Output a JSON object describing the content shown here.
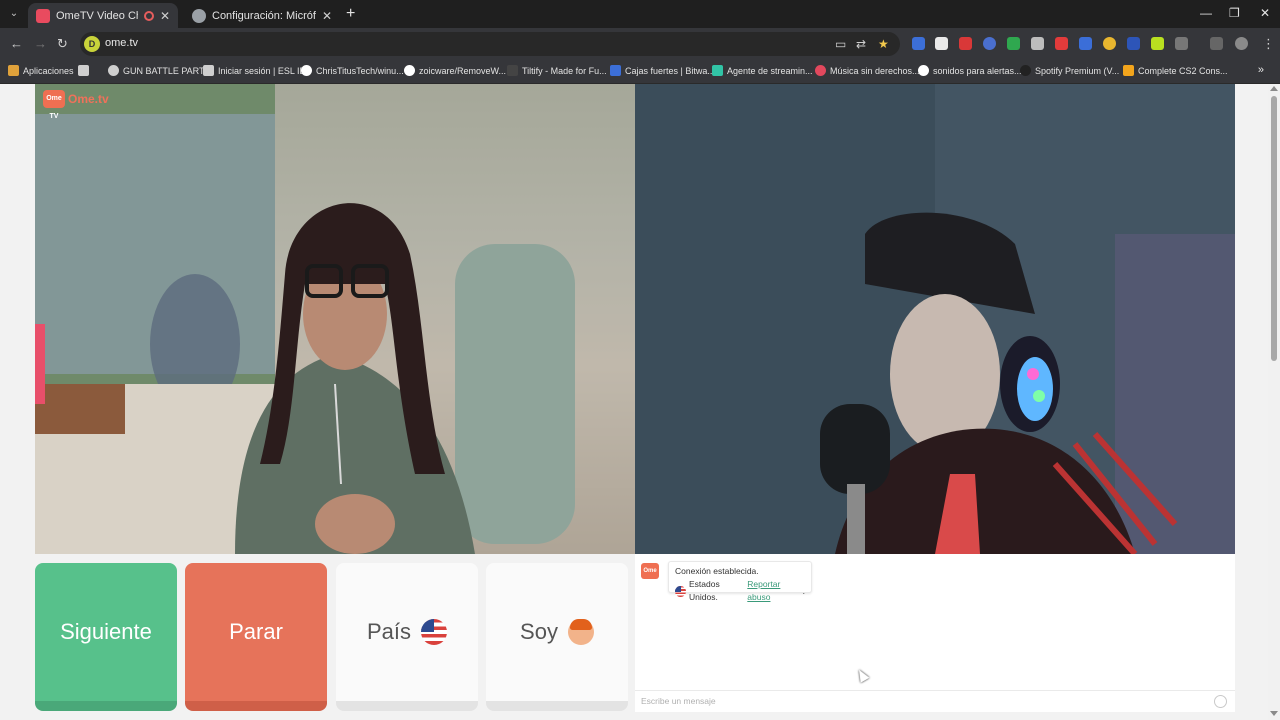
{
  "browser": {
    "tabs": [
      {
        "title": "OmeTV Video Chat — Ome",
        "active": true,
        "favicon_color": "#e94b5f"
      },
      {
        "title": "Configuración: Micrófono",
        "active": false,
        "favicon_color": "#9aa0a6"
      }
    ],
    "address": "ome.tv",
    "bookmarks": [
      {
        "label": "Aplicaciones",
        "icon": "apps-icon",
        "color": "#e0a23b"
      },
      {
        "label": "GUN BATTLE PARTY",
        "icon": "globe-icon",
        "color": "#cfcfcf"
      },
      {
        "label": "Iniciar sesión | ESL ID",
        "icon": "pen-icon",
        "color": "#cfcfcf"
      },
      {
        "label": "ChrisTitusTech/winu...",
        "icon": "github-icon",
        "color": "#ffffff"
      },
      {
        "label": "zoicware/RemoveW...",
        "icon": "github-icon",
        "color": "#ffffff"
      },
      {
        "label": "Tiltify - Made for Fu...",
        "icon": "tiltify-icon",
        "color": "#444444"
      },
      {
        "label": "Cajas fuertes | Bitwa...",
        "icon": "shield-icon",
        "color": "#3c6fd8"
      },
      {
        "label": "Agente de streamin...",
        "icon": "stream-icon",
        "color": "#31c4a6"
      },
      {
        "label": "Música sin derechos...",
        "icon": "music-icon",
        "color": "#e2485d"
      },
      {
        "label": "sonidos para alertas...",
        "icon": "google-icon",
        "color": "#ffffff"
      },
      {
        "label": "Spotify Premium (V...",
        "icon": "spotify-icon",
        "color": "#222222"
      },
      {
        "label": "Complete CS2 Cons...",
        "icon": "t-icon",
        "color": "#f3a51c"
      }
    ]
  },
  "app": {
    "logo_text": "Ome.tv",
    "logo_badge": "Ome TV"
  },
  "buttons": {
    "next": "Siguiente",
    "stop": "Parar",
    "country": "País",
    "gender": "Soy"
  },
  "chat": {
    "status": "Conexión establecida.",
    "country": "Estados Unidos.",
    "report": "Reportar abuso",
    "report_suffix": ".",
    "placeholder": "Escribe un mensaje"
  }
}
